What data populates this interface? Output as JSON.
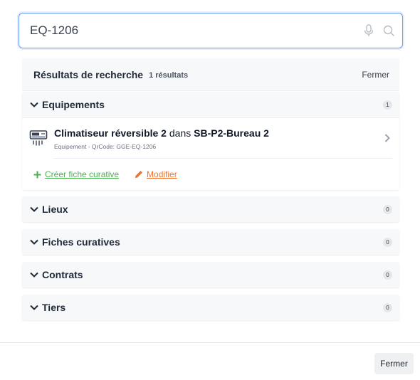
{
  "search": {
    "value": "EQ-1206"
  },
  "results": {
    "title": "Résultats de recherche",
    "count": "1 résultats",
    "close_label": "Fermer"
  },
  "sections": [
    {
      "title": "Equipements",
      "count": "1",
      "items": [
        {
          "name_bold": "Climatiseur réversible 2",
          "connector": " dans ",
          "location_bold": "SB-P2-Bureau 2",
          "subtitle": "Equipement - QrCode: GGE-EQ-1206",
          "icon": "air-conditioner-icon"
        }
      ],
      "actions": {
        "create_label": "Créer fiche curative",
        "edit_label": "Modifier"
      }
    },
    {
      "title": "Lieux",
      "count": "0"
    },
    {
      "title": "Fiches curatives",
      "count": "0"
    },
    {
      "title": "Contrats",
      "count": "0"
    },
    {
      "title": "Tiers",
      "count": "0"
    }
  ],
  "footer": {
    "close_label": "Fermer"
  },
  "colors": {
    "accent": "#6b9ef5",
    "create": "#4caf50",
    "edit": "#f0732d"
  }
}
